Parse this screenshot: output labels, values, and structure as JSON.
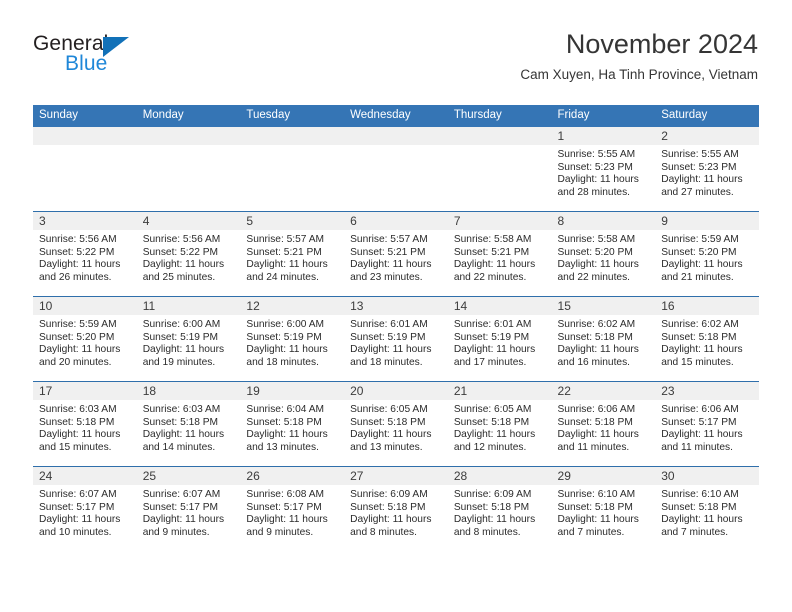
{
  "logo": {
    "text_primary": "General",
    "text_secondary": "Blue",
    "icon": "triangle-icon",
    "color_primary": "#231f20",
    "color_secondary": "#1f87d8",
    "triangle_color": "#1271b8"
  },
  "header": {
    "month_title": "November 2024",
    "location": "Cam Xuyen, Ha Tinh Province, Vietnam"
  },
  "theme": {
    "header_row_bg": "#3575b5",
    "row_separator": "#2f6fab",
    "daynum_band_bg": "#f0f0f0",
    "text": "#2b2b2b"
  },
  "weekday_headers": [
    "Sunday",
    "Monday",
    "Tuesday",
    "Wednesday",
    "Thursday",
    "Friday",
    "Saturday"
  ],
  "weeks": [
    [
      {
        "day": "",
        "sunrise": "",
        "sunset": "",
        "daylight_1": "",
        "daylight_2": "",
        "empty": true
      },
      {
        "day": "",
        "sunrise": "",
        "sunset": "",
        "daylight_1": "",
        "daylight_2": "",
        "empty": true
      },
      {
        "day": "",
        "sunrise": "",
        "sunset": "",
        "daylight_1": "",
        "daylight_2": "",
        "empty": true
      },
      {
        "day": "",
        "sunrise": "",
        "sunset": "",
        "daylight_1": "",
        "daylight_2": "",
        "empty": true
      },
      {
        "day": "",
        "sunrise": "",
        "sunset": "",
        "daylight_1": "",
        "daylight_2": "",
        "empty": true
      },
      {
        "day": "1",
        "sunrise": "Sunrise: 5:55 AM",
        "sunset": "Sunset: 5:23 PM",
        "daylight_1": "Daylight: 11 hours",
        "daylight_2": "and 28 minutes."
      },
      {
        "day": "2",
        "sunrise": "Sunrise: 5:55 AM",
        "sunset": "Sunset: 5:23 PM",
        "daylight_1": "Daylight: 11 hours",
        "daylight_2": "and 27 minutes."
      }
    ],
    [
      {
        "day": "3",
        "sunrise": "Sunrise: 5:56 AM",
        "sunset": "Sunset: 5:22 PM",
        "daylight_1": "Daylight: 11 hours",
        "daylight_2": "and 26 minutes."
      },
      {
        "day": "4",
        "sunrise": "Sunrise: 5:56 AM",
        "sunset": "Sunset: 5:22 PM",
        "daylight_1": "Daylight: 11 hours",
        "daylight_2": "and 25 minutes."
      },
      {
        "day": "5",
        "sunrise": "Sunrise: 5:57 AM",
        "sunset": "Sunset: 5:21 PM",
        "daylight_1": "Daylight: 11 hours",
        "daylight_2": "and 24 minutes."
      },
      {
        "day": "6",
        "sunrise": "Sunrise: 5:57 AM",
        "sunset": "Sunset: 5:21 PM",
        "daylight_1": "Daylight: 11 hours",
        "daylight_2": "and 23 minutes."
      },
      {
        "day": "7",
        "sunrise": "Sunrise: 5:58 AM",
        "sunset": "Sunset: 5:21 PM",
        "daylight_1": "Daylight: 11 hours",
        "daylight_2": "and 22 minutes."
      },
      {
        "day": "8",
        "sunrise": "Sunrise: 5:58 AM",
        "sunset": "Sunset: 5:20 PM",
        "daylight_1": "Daylight: 11 hours",
        "daylight_2": "and 22 minutes."
      },
      {
        "day": "9",
        "sunrise": "Sunrise: 5:59 AM",
        "sunset": "Sunset: 5:20 PM",
        "daylight_1": "Daylight: 11 hours",
        "daylight_2": "and 21 minutes."
      }
    ],
    [
      {
        "day": "10",
        "sunrise": "Sunrise: 5:59 AM",
        "sunset": "Sunset: 5:20 PM",
        "daylight_1": "Daylight: 11 hours",
        "daylight_2": "and 20 minutes."
      },
      {
        "day": "11",
        "sunrise": "Sunrise: 6:00 AM",
        "sunset": "Sunset: 5:19 PM",
        "daylight_1": "Daylight: 11 hours",
        "daylight_2": "and 19 minutes."
      },
      {
        "day": "12",
        "sunrise": "Sunrise: 6:00 AM",
        "sunset": "Sunset: 5:19 PM",
        "daylight_1": "Daylight: 11 hours",
        "daylight_2": "and 18 minutes."
      },
      {
        "day": "13",
        "sunrise": "Sunrise: 6:01 AM",
        "sunset": "Sunset: 5:19 PM",
        "daylight_1": "Daylight: 11 hours",
        "daylight_2": "and 18 minutes."
      },
      {
        "day": "14",
        "sunrise": "Sunrise: 6:01 AM",
        "sunset": "Sunset: 5:19 PM",
        "daylight_1": "Daylight: 11 hours",
        "daylight_2": "and 17 minutes."
      },
      {
        "day": "15",
        "sunrise": "Sunrise: 6:02 AM",
        "sunset": "Sunset: 5:18 PM",
        "daylight_1": "Daylight: 11 hours",
        "daylight_2": "and 16 minutes."
      },
      {
        "day": "16",
        "sunrise": "Sunrise: 6:02 AM",
        "sunset": "Sunset: 5:18 PM",
        "daylight_1": "Daylight: 11 hours",
        "daylight_2": "and 15 minutes."
      }
    ],
    [
      {
        "day": "17",
        "sunrise": "Sunrise: 6:03 AM",
        "sunset": "Sunset: 5:18 PM",
        "daylight_1": "Daylight: 11 hours",
        "daylight_2": "and 15 minutes."
      },
      {
        "day": "18",
        "sunrise": "Sunrise: 6:03 AM",
        "sunset": "Sunset: 5:18 PM",
        "daylight_1": "Daylight: 11 hours",
        "daylight_2": "and 14 minutes."
      },
      {
        "day": "19",
        "sunrise": "Sunrise: 6:04 AM",
        "sunset": "Sunset: 5:18 PM",
        "daylight_1": "Daylight: 11 hours",
        "daylight_2": "and 13 minutes."
      },
      {
        "day": "20",
        "sunrise": "Sunrise: 6:05 AM",
        "sunset": "Sunset: 5:18 PM",
        "daylight_1": "Daylight: 11 hours",
        "daylight_2": "and 13 minutes."
      },
      {
        "day": "21",
        "sunrise": "Sunrise: 6:05 AM",
        "sunset": "Sunset: 5:18 PM",
        "daylight_1": "Daylight: 11 hours",
        "daylight_2": "and 12 minutes."
      },
      {
        "day": "22",
        "sunrise": "Sunrise: 6:06 AM",
        "sunset": "Sunset: 5:18 PM",
        "daylight_1": "Daylight: 11 hours",
        "daylight_2": "and 11 minutes."
      },
      {
        "day": "23",
        "sunrise": "Sunrise: 6:06 AM",
        "sunset": "Sunset: 5:17 PM",
        "daylight_1": "Daylight: 11 hours",
        "daylight_2": "and 11 minutes."
      }
    ],
    [
      {
        "day": "24",
        "sunrise": "Sunrise: 6:07 AM",
        "sunset": "Sunset: 5:17 PM",
        "daylight_1": "Daylight: 11 hours",
        "daylight_2": "and 10 minutes."
      },
      {
        "day": "25",
        "sunrise": "Sunrise: 6:07 AM",
        "sunset": "Sunset: 5:17 PM",
        "daylight_1": "Daylight: 11 hours",
        "daylight_2": "and 9 minutes."
      },
      {
        "day": "26",
        "sunrise": "Sunrise: 6:08 AM",
        "sunset": "Sunset: 5:17 PM",
        "daylight_1": "Daylight: 11 hours",
        "daylight_2": "and 9 minutes."
      },
      {
        "day": "27",
        "sunrise": "Sunrise: 6:09 AM",
        "sunset": "Sunset: 5:18 PM",
        "daylight_1": "Daylight: 11 hours",
        "daylight_2": "and 8 minutes."
      },
      {
        "day": "28",
        "sunrise": "Sunrise: 6:09 AM",
        "sunset": "Sunset: 5:18 PM",
        "daylight_1": "Daylight: 11 hours",
        "daylight_2": "and 8 minutes."
      },
      {
        "day": "29",
        "sunrise": "Sunrise: 6:10 AM",
        "sunset": "Sunset: 5:18 PM",
        "daylight_1": "Daylight: 11 hours",
        "daylight_2": "and 7 minutes."
      },
      {
        "day": "30",
        "sunrise": "Sunrise: 6:10 AM",
        "sunset": "Sunset: 5:18 PM",
        "daylight_1": "Daylight: 11 hours",
        "daylight_2": "and 7 minutes."
      }
    ]
  ]
}
